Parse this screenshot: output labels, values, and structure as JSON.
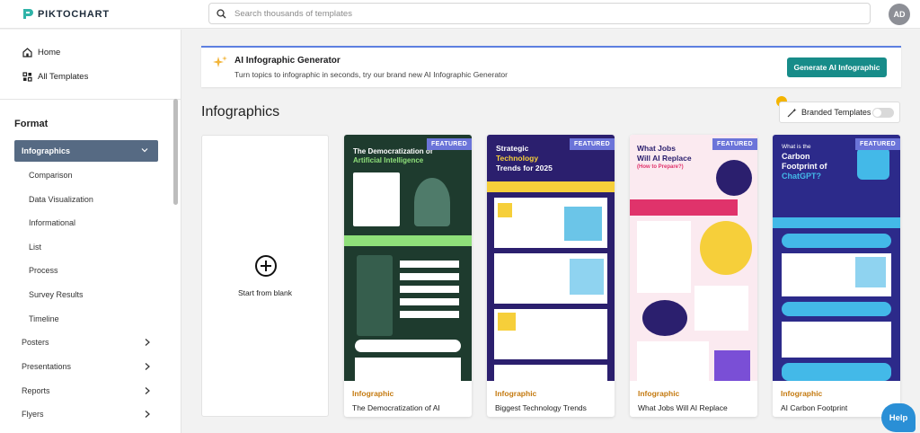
{
  "brand": {
    "name": "PIKTOCHART"
  },
  "search": {
    "placeholder": "Search thousands of templates"
  },
  "user": {
    "initials": "AD"
  },
  "sidebar": {
    "home": "Home",
    "all_templates": "All Templates",
    "format_title": "Format",
    "active": "Infographics",
    "subitems": [
      "Comparison",
      "Data Visualization",
      "Informational",
      "List",
      "Process",
      "Survey Results",
      "Timeline"
    ],
    "categories": [
      "Posters",
      "Presentations",
      "Reports",
      "Flyers"
    ]
  },
  "banner": {
    "title": "AI Infographic Generator",
    "description": "Turn topics to infographic in seconds, try our brand new AI Infographic Generator",
    "button": "Generate AI Infographic"
  },
  "section": {
    "title": "Infographics",
    "branded_label": "Branded Templates",
    "branded_on": false
  },
  "blank": {
    "label": "Start from blank"
  },
  "cards": [
    {
      "badge": "FEATURED",
      "category": "Infographic",
      "title": "The Democratization of AI",
      "thumb_heading_1": "The Democratization of",
      "thumb_heading_2": "Artificial Intelligence",
      "bg": "#1e3b2e",
      "accent": "#8fe07a"
    },
    {
      "badge": "FEATURED",
      "category": "Infographic",
      "title": "Biggest Technology Trends",
      "thumb_heading_1": "Strategic",
      "thumb_heading_2": "Technology",
      "thumb_heading_3": "Trends for 2025",
      "bg": "#2b1f6e",
      "accent": "#f6cf3a"
    },
    {
      "badge": "FEATURED",
      "category": "Infographic",
      "title": "What Jobs Will AI Replace",
      "thumb_heading_1": "What Jobs",
      "thumb_heading_2": "Will AI Replace",
      "thumb_heading_3": "(How to Prepare?)",
      "bg": "#fbeaf0",
      "accent": "#e0336b"
    },
    {
      "badge": "FEATURED",
      "category": "Infographic",
      "title": "AI Carbon Footprint",
      "thumb_heading_1": "What is the",
      "thumb_heading_2": "Carbon",
      "thumb_heading_3": "Footprint of",
      "thumb_heading_4": "ChatGPT?",
      "bg": "#2c2a8a",
      "accent": "#43b9e8"
    }
  ],
  "help": {
    "label": "Help"
  },
  "colors": {
    "accent": "#178c89",
    "sidebar_active": "#566a83",
    "featured": "#6b74d9",
    "category": "#c47a10"
  }
}
